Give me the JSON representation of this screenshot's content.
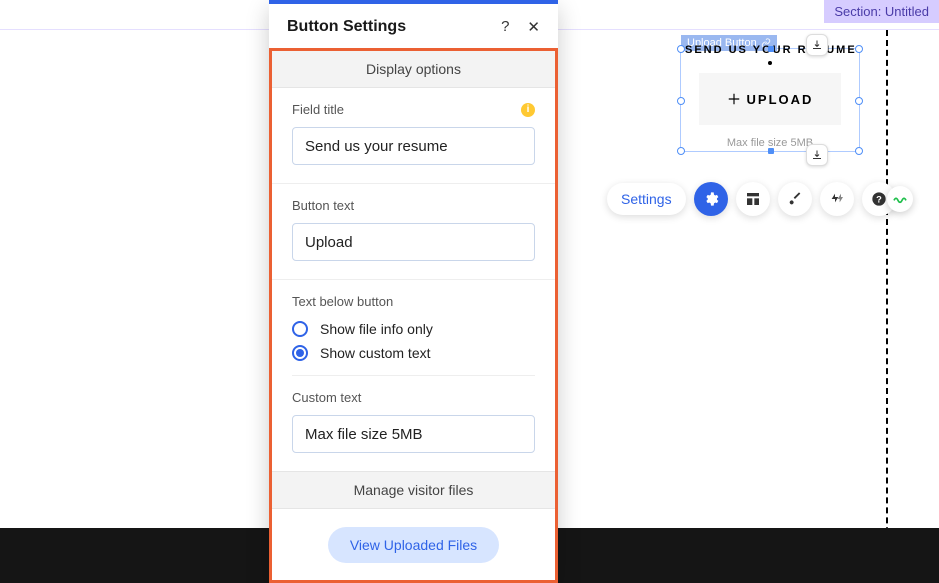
{
  "section_badge": "Section: Untitled",
  "panel": {
    "title": "Button Settings",
    "display_options_header": "Display options",
    "field_title_label": "Field title",
    "field_title_value": "Send us your resume",
    "button_text_label": "Button text",
    "button_text_value": "Upload",
    "text_below_label": "Text below button",
    "radio_info_only": "Show file info only",
    "radio_custom": "Show custom text",
    "text_below_selected": "custom",
    "custom_text_label": "Custom text",
    "custom_text_value": "Max file size 5MB",
    "manage_header": "Manage visitor files",
    "view_uploaded_label": "View Uploaded Files"
  },
  "widget": {
    "tag": "Upload Button",
    "title": "SEND US YOUR RESUME",
    "button": "UPLOAD",
    "caption": "Max file size 5MB"
  },
  "toolbar": {
    "settings_label": "Settings"
  }
}
